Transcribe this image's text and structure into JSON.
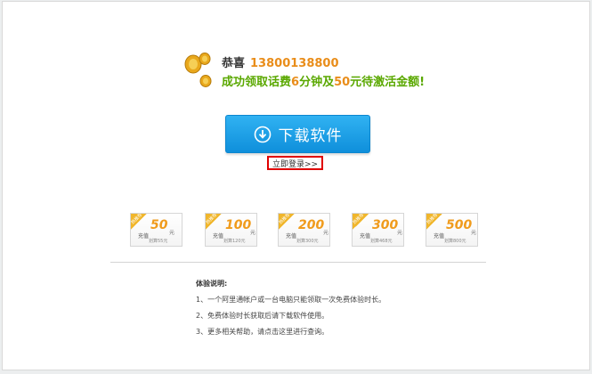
{
  "header": {
    "congrats_label": "恭喜",
    "phone": "13800138800",
    "reward_prefix": "成功领取话费",
    "minutes": "6",
    "reward_mid": "分钟及",
    "yuan": "50",
    "reward_suffix": "元待激活金额!"
  },
  "download_button": {
    "label": "下载软件",
    "icon": "download-circle-icon"
  },
  "login_link": {
    "label": "立即登录>>"
  },
  "cards": [
    {
      "badge": "热推荐",
      "label": "充值",
      "amount": "50",
      "unit": "元",
      "bonus": "划算55元"
    },
    {
      "badge": "热推荐",
      "label": "充值",
      "amount": "100",
      "unit": "元",
      "bonus": "划算120元"
    },
    {
      "badge": "热推荐",
      "label": "充值",
      "amount": "200",
      "unit": "元",
      "bonus": "划算300元"
    },
    {
      "badge": "热推荐",
      "label": "充值",
      "amount": "300",
      "unit": "元",
      "bonus": "划算468元"
    },
    {
      "badge": "热推荐",
      "label": "充值",
      "amount": "500",
      "unit": "元",
      "bonus": "划算800元"
    }
  ],
  "notes": {
    "title": "体验说明:",
    "items": [
      "1、一个阿里通帐户或一台电脑只能领取一次免费体验时长。",
      "2、免费体验时长获取后请下载软件使用。",
      "3、更多相关帮助，请点击这里进行查询。"
    ]
  },
  "colors": {
    "accent_blue": "#1a9be4",
    "orange": "#e98d1a",
    "green": "#5aa800",
    "highlight_red": "#e00000"
  }
}
